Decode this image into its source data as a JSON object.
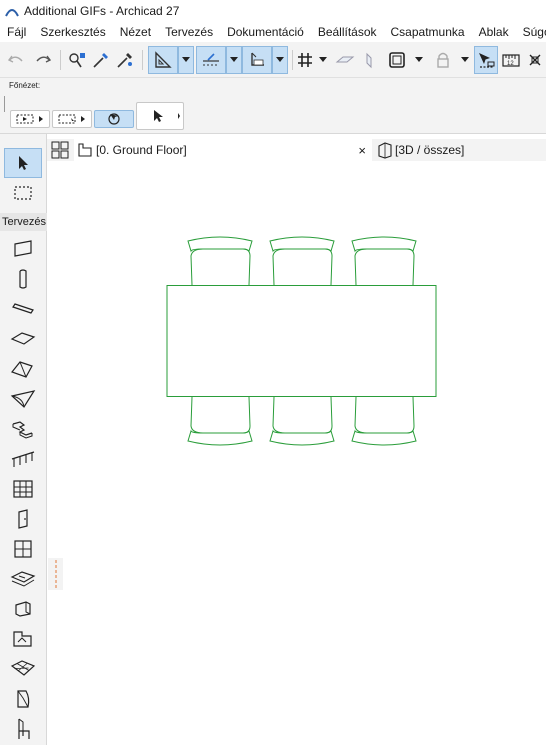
{
  "window": {
    "title": "Additional GIFs - Archicad 27"
  },
  "menubar": {
    "items": [
      "Fájl",
      "Szerkesztés",
      "Nézet",
      "Tervezés",
      "Dokumentáció",
      "Beállítások",
      "Csapatmunka",
      "Ablak",
      "Súgó"
    ]
  },
  "infobox": {
    "label": "Főnézet:"
  },
  "leftpanel": {
    "section_label": "Tervezés"
  },
  "tabs": {
    "floor_plan": "[0. Ground Floor]",
    "close_symbol": "×",
    "view_3d": "[3D / összes]"
  },
  "colors": {
    "accent": "#c6dff5",
    "accent_border": "#8fb9df",
    "drawing_stroke": "#2a9d3a",
    "panel_bg": "#f3f3f3"
  },
  "icons": {
    "toolbar": [
      "undo-icon",
      "redo-icon",
      "pick-up-icon",
      "eyedropper-icon",
      "inject-icon",
      "snap-guides-icon",
      "dropdown-arrow-icon",
      "edit-plane-icon",
      "dropdown-arrow-icon",
      "coordinates-icon",
      "dropdown-arrow-icon",
      "grid-snap-icon",
      "dropdown-arrow-icon",
      "layer-icon",
      "surface-icon",
      "renovation-icon",
      "dropdown-arrow-icon",
      "lock-icon",
      "dropdown-arrow-icon",
      "tracker-icon",
      "measure-icon",
      "hotspot-icon"
    ],
    "tools": [
      "arrow-select-icon",
      "marquee-icon",
      "wall-icon",
      "column-icon",
      "beam-icon",
      "slab-icon",
      "roof-icon",
      "shell-icon",
      "stair-icon",
      "railing-icon",
      "curtain-wall-icon",
      "door-icon",
      "window-icon",
      "skylight-icon",
      "wall-end-icon",
      "corner-window-icon",
      "object-icon",
      "mesh-icon",
      "zone-icon",
      "chair-icon"
    ]
  }
}
